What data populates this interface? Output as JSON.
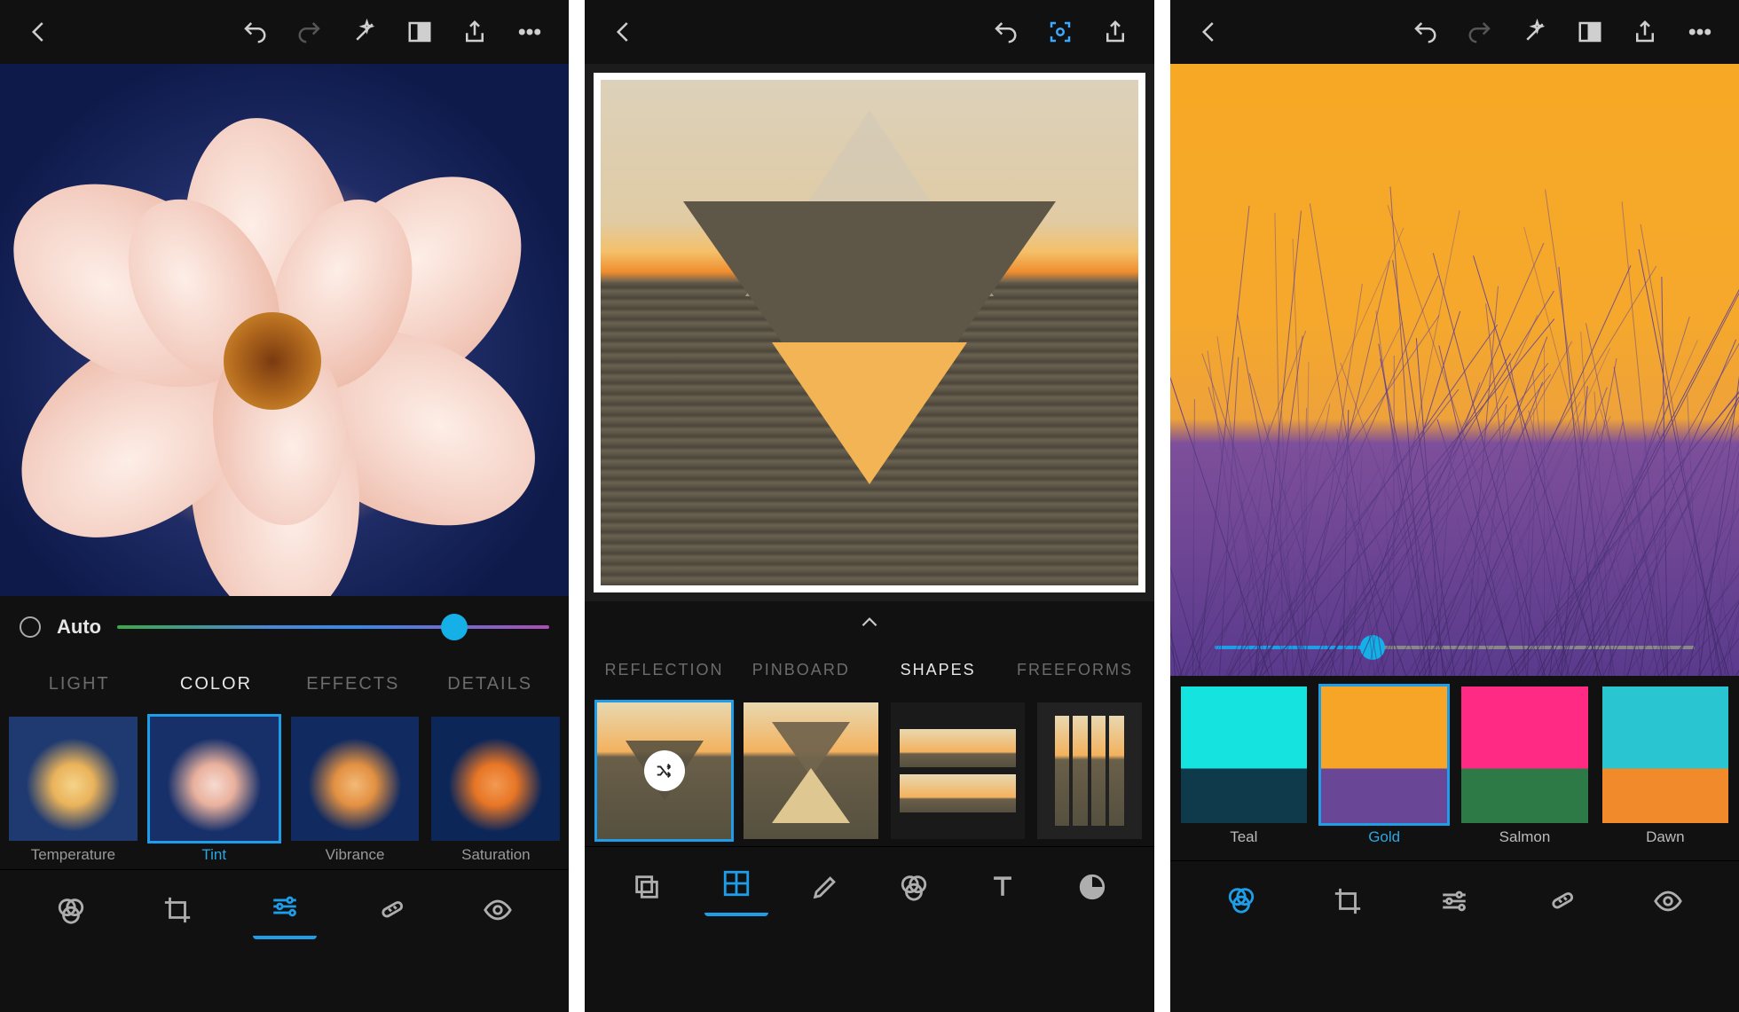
{
  "panel1": {
    "auto_label": "Auto",
    "slider_value": 78,
    "tabs": [
      {
        "label": "LIGHT",
        "active": false
      },
      {
        "label": "COLOR",
        "active": true
      },
      {
        "label": "EFFECTS",
        "active": false
      },
      {
        "label": "DETAILS",
        "active": false
      }
    ],
    "thumbs": [
      {
        "label": "Temperature",
        "selected": false
      },
      {
        "label": "Tint",
        "selected": true
      },
      {
        "label": "Vibrance",
        "selected": false
      },
      {
        "label": "Saturation",
        "selected": false
      }
    ]
  },
  "panel2": {
    "tabs": [
      {
        "label": "REFLECTION",
        "active": false
      },
      {
        "label": "PINBOARD",
        "active": false
      },
      {
        "label": "SHAPES",
        "active": true
      },
      {
        "label": "FREEFORMS",
        "active": false
      }
    ],
    "shape_thumbs_selected_index": 0
  },
  "panel3": {
    "slider_value": 33,
    "swatches": [
      {
        "label": "Teal",
        "colors": [
          "#14e3e0",
          "#0f3a4c"
        ]
      },
      {
        "label": "Gold",
        "colors": [
          "#f6a526",
          "#6a4696"
        ]
      },
      {
        "label": "Salmon",
        "colors": [
          "#ff2a84",
          "#2e7a46"
        ]
      },
      {
        "label": "Dawn",
        "colors": [
          "#29c6d1",
          "#f08a2a"
        ]
      }
    ],
    "swatches_selected_index": 1
  }
}
